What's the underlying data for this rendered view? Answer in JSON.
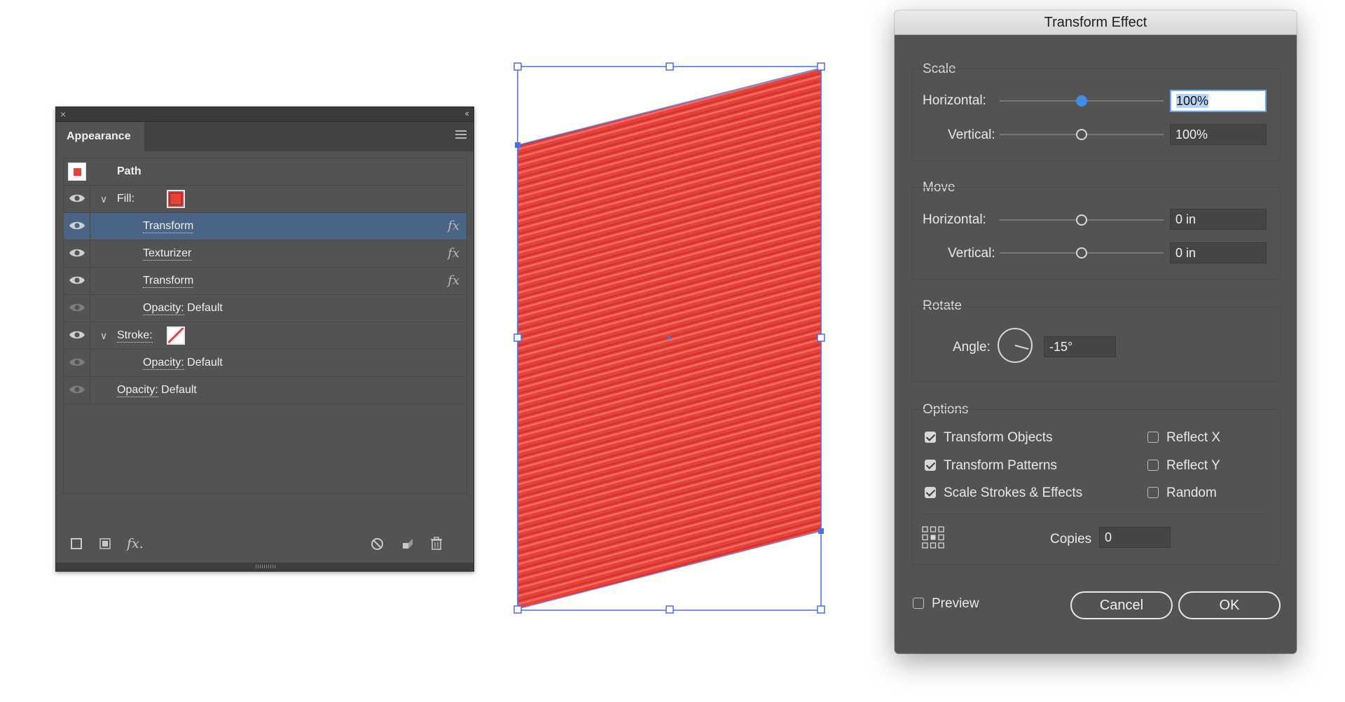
{
  "appearance_panel": {
    "tab": "Appearance",
    "close_glyph": "×",
    "collapse_glyph": "‹‹",
    "object_label": "Path",
    "rows": [
      {
        "label": "Fill:",
        "kind": "fill"
      },
      {
        "label": "Transform",
        "kind": "effect",
        "fx": "fx",
        "selected": true
      },
      {
        "label": "Texturizer",
        "kind": "effect",
        "fx": "fx"
      },
      {
        "label": "Transform",
        "kind": "effect",
        "fx": "fx"
      },
      {
        "label": "Opacity:",
        "value": "Default",
        "kind": "opacity"
      },
      {
        "label": "Stroke:",
        "kind": "stroke"
      },
      {
        "label": "Opacity:",
        "value": "Default",
        "kind": "opacity"
      },
      {
        "label": "Opacity:",
        "value": "Default",
        "kind": "opacity"
      }
    ],
    "fill_color": "#e8413a",
    "bottom_icons": [
      "new-stroke-icon",
      "new-fill-icon",
      "add-effect-icon",
      "clear-appearance-icon",
      "duplicate-item-icon",
      "trash-icon"
    ],
    "add_effect_glyph": "fx."
  },
  "artwork": {
    "fill_color": "#e8413a",
    "selection_color": "#4a6fe8"
  },
  "dialog": {
    "title": "Transform Effect",
    "scale": {
      "label": "Scale",
      "horizontal_label": "Horizontal:",
      "horizontal_value": "100%",
      "vertical_label": "Vertical:",
      "vertical_value": "100%"
    },
    "move": {
      "label": "Move",
      "horizontal_label": "Horizontal:",
      "horizontal_value": "0 in",
      "vertical_label": "Vertical:",
      "vertical_value": "0 in"
    },
    "rotate": {
      "label": "Rotate",
      "angle_label": "Angle:",
      "angle_value": "-15°"
    },
    "options": {
      "label": "Options",
      "transform_objects": "Transform Objects",
      "transform_patterns": "Transform Patterns",
      "scale_strokes": "Scale Strokes & Effects",
      "reflect_x": "Reflect X",
      "reflect_y": "Reflect Y",
      "random": "Random",
      "copies_label": "Copies",
      "copies_value": "0"
    },
    "preview_label": "Preview",
    "cancel_label": "Cancel",
    "ok_label": "OK"
  }
}
